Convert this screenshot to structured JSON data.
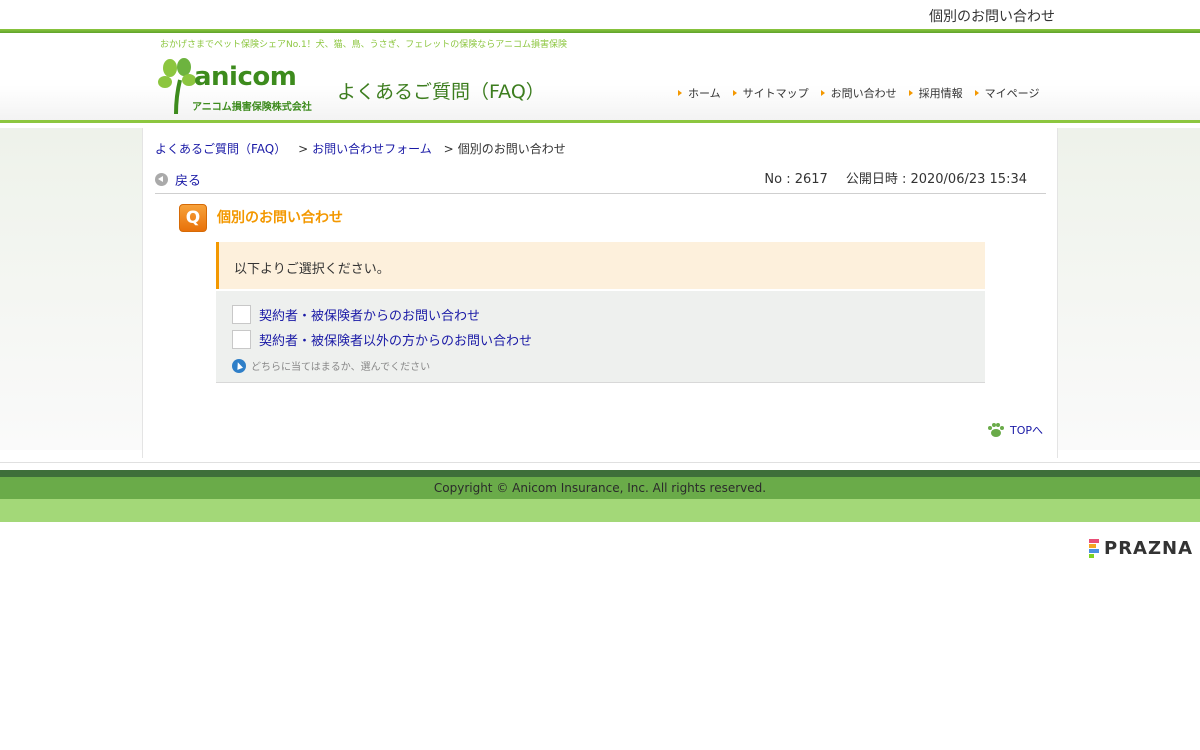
{
  "top": {
    "page_title": "個別のお問い合わせ"
  },
  "header": {
    "tagline": "おかげさまでペット保険シェアNo.1！犬、猫、鳥、うさぎ、フェレットの保険ならアニコム損害保険",
    "logo_word": "anicom",
    "logo_company": "アニコム損害保険株式会社",
    "site_title": "よくあるご質問（FAQ）",
    "nav": [
      "ホーム",
      "サイトマップ",
      "お問い合わせ",
      "採用情報",
      "マイページ"
    ]
  },
  "breadcrumb": {
    "home": "よくあるご質問（FAQ）",
    "sep": ">",
    "parent": "お問い合わせフォーム",
    "current": "個別のお問い合わせ"
  },
  "back_label": "戻る",
  "meta": {
    "no": "No : 2617",
    "published": "公開日時 : 2020/06/23 15:34"
  },
  "question": {
    "icon_letter": "Q",
    "title": "個別のお問い合わせ"
  },
  "notice": "以下よりご選択ください。",
  "choices": [
    "契約者・被保険者からのお問い合わせ",
    "契約者・被保険者以外の方からのお問い合わせ"
  ],
  "hint": "どちらに当てはまるか、選んでください",
  "to_top": "TOPへ",
  "footer": {
    "copyright": "Copyright © Anicom Insurance, Inc. All rights reserved."
  },
  "badge": {
    "word": "PRAZNA"
  },
  "colors": {
    "accent_green": "#8cc63f",
    "dark_green": "#3d8b1d",
    "orange": "#f39800",
    "link": "#1a1aa6"
  }
}
